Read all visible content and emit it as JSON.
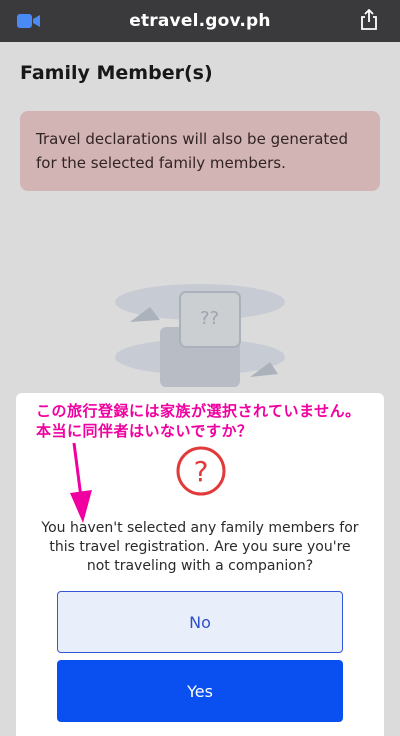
{
  "browser": {
    "url": "etravel.gov.ph",
    "icons": {
      "left": "video-camera-icon",
      "right": "share-icon"
    }
  },
  "page": {
    "title": "Family Member(s)",
    "notice": "Travel declarations will also be generated for the selected family members."
  },
  "annotation": {
    "line1": "この旅行登録には家族が選択されていません。",
    "line2": "本当に同伴者はいないですか？",
    "color": "#f000a0"
  },
  "dialog": {
    "icon": "question-circle-icon",
    "message": "You haven't selected any family members for this travel registration. Are you sure you're not traveling with a companion?",
    "no_label": "No",
    "yes_label": "Yes",
    "colors": {
      "accent": "#0a4ff0",
      "warning": "#e23a3a",
      "notice_bg": "#f6d2d2"
    }
  }
}
